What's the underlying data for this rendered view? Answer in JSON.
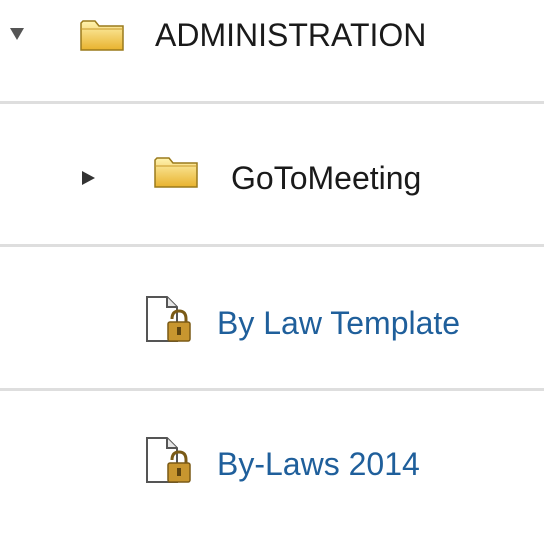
{
  "tree": {
    "items": [
      {
        "label": "ADMINISTRATION",
        "type": "folder",
        "expanded": true,
        "toggle_icon": "caret-down-icon",
        "item_icon": "folder-icon"
      },
      {
        "label": "GoToMeeting",
        "type": "folder",
        "expanded": false,
        "toggle_icon": "caret-right-icon",
        "item_icon": "folder-icon"
      },
      {
        "label": "By Law Template",
        "type": "document",
        "item_icon": "locked-document-icon"
      },
      {
        "label": "By-Laws 2014",
        "type": "document",
        "item_icon": "locked-document-icon"
      }
    ]
  },
  "colors": {
    "folder_text": "#1a1a1a",
    "document_link": "#1f5f9b",
    "divider": "#dedede",
    "folder_fill": "#f2c94c",
    "lock": "#b8862b"
  }
}
